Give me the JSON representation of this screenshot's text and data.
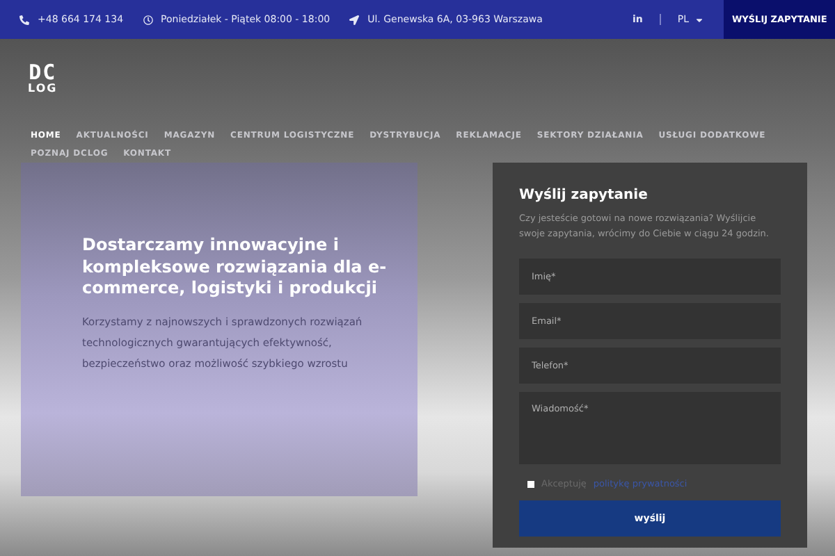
{
  "topbar": {
    "phone": "+48 664 174 134",
    "hours": "Poniedziałek - Piątek 08:00 - 18:00",
    "address": "Ul. Genewska 6A, 03-963 Warszawa",
    "social": "in",
    "language": "PL",
    "cta": "WYŚLIJ ZAPYTANIE"
  },
  "logo": {
    "top": "DC",
    "bottom": "LOG"
  },
  "nav": [
    {
      "label": "HOME",
      "selected": true
    },
    {
      "label": "AKTUALNOŚCI",
      "selected": false
    },
    {
      "label": "MAGAZYN",
      "selected": false
    },
    {
      "label": "CENTRUM LOGISTYCZNE",
      "selected": false
    },
    {
      "label": "DYSTRYBUCJA",
      "selected": false
    },
    {
      "label": "REKLAMACJE",
      "selected": false
    },
    {
      "label": "SEKTORY DZIAŁANIA",
      "selected": false
    },
    {
      "label": "USŁUGI DODATKOWE",
      "selected": false
    },
    {
      "label": "POZNAJ DCLOG",
      "selected": false
    },
    {
      "label": "KONTAKT",
      "selected": false
    }
  ],
  "hero": {
    "heading": "Dostarczamy innowacyjne i kompleksowe rozwiązania dla e-commerce, logistyki i produkcji",
    "text": "Korzystamy z najnowszych i sprawdzonych rozwiązań technologicznych gwarantujących efektywność, bezpieczeństwo oraz możliwość szybkiego wzrostu"
  },
  "form": {
    "title": "Wyślij zapytanie",
    "description": "Czy jesteście gotowi na nowe rozwiązania? Wyślijcie swoje zapytania, wrócimy do Ciebie w ciągu 24 godzin.",
    "fields": [
      {
        "placeholder": "Imię*",
        "kind": "input"
      },
      {
        "placeholder": "Email*",
        "kind": "input"
      },
      {
        "placeholder": "Telefon*",
        "kind": "input"
      },
      {
        "placeholder": "Wiadomość*",
        "kind": "textarea"
      }
    ],
    "consent": {
      "label": "Akceptuję",
      "link": "politykę prywatności",
      "checked": false
    },
    "submit": "wyślij"
  }
}
